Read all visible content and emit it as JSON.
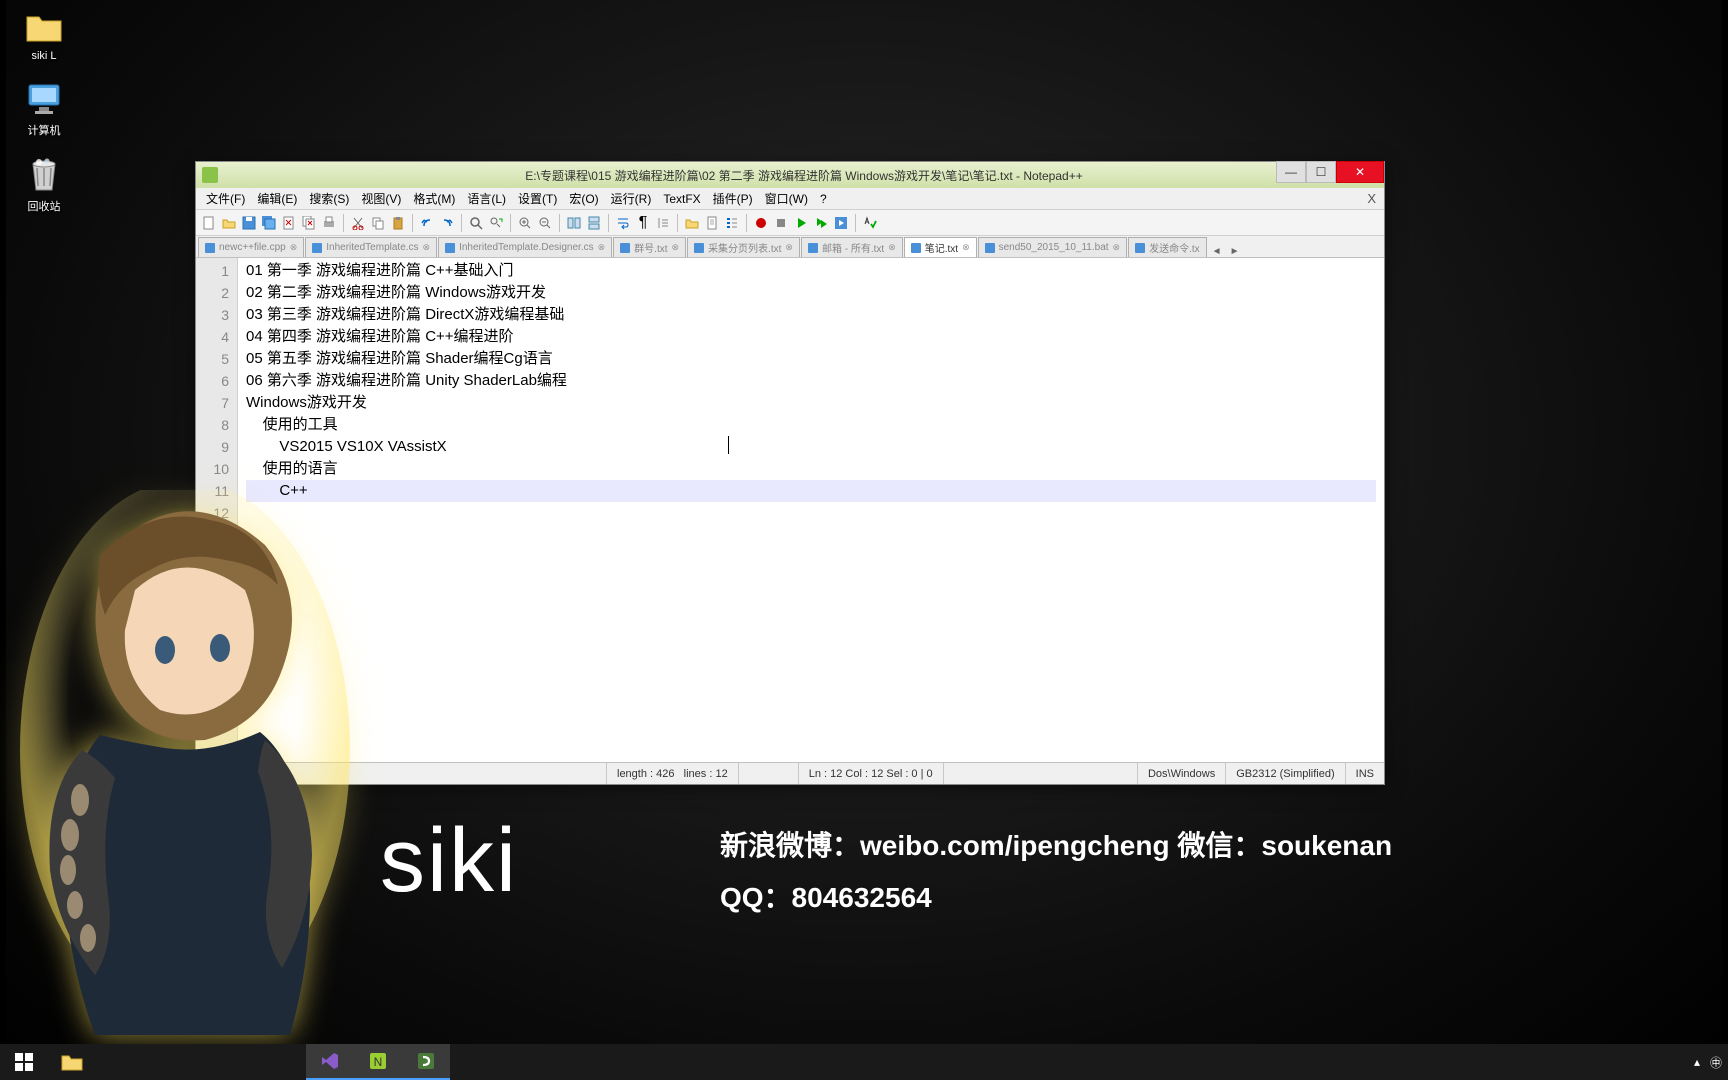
{
  "desktop": {
    "icons": [
      {
        "name": "folder-siki-l",
        "label": "siki L",
        "type": "folder"
      },
      {
        "name": "computer",
        "label": "计算机",
        "type": "computer"
      },
      {
        "name": "recycle-bin",
        "label": "回收站",
        "type": "recycle"
      }
    ]
  },
  "window": {
    "title": "E:\\专题课程\\015 游戏编程进阶篇\\02 第二季 游戏编程进阶篇 Windows游戏开发\\笔记\\笔记.txt - Notepad++",
    "menus": [
      "文件(F)",
      "编辑(E)",
      "搜索(S)",
      "视图(V)",
      "格式(M)",
      "语言(L)",
      "设置(T)",
      "宏(O)",
      "运行(R)",
      "TextFX",
      "插件(P)",
      "窗口(W)",
      "?"
    ],
    "tabs": [
      {
        "label": "newc++file.cpp",
        "active": false
      },
      {
        "label": "InheritedTemplate.cs",
        "active": false
      },
      {
        "label": "InheritedTemplate.Designer.cs",
        "active": false
      },
      {
        "label": "群号.txt",
        "active": false
      },
      {
        "label": "采集分页列表.txt",
        "active": false
      },
      {
        "label": "邮箱 - 所有.txt",
        "active": false
      },
      {
        "label": "笔记.txt",
        "active": true
      },
      {
        "label": "send50_2015_10_11.bat",
        "active": false
      },
      {
        "label": "发送命令.tx",
        "active": false
      }
    ],
    "lines": [
      "01 第一季 游戏编程进阶篇 C++基础入门",
      "02 第二季 游戏编程进阶篇 Windows游戏开发",
      "03 第三季 游戏编程进阶篇 DirectX游戏编程基础",
      "04 第四季 游戏编程进阶篇 C++编程进阶",
      "05 第五季 游戏编程进阶篇 Shader编程Cg语言",
      "06 第六季 游戏编程进阶篇 Unity ShaderLab编程",
      "",
      "Windows游戏开发",
      "    使用的工具",
      "        VS2015 VS10X VAssistX",
      "    使用的语言",
      "        C++"
    ],
    "status": {
      "length": "length : 426",
      "lines": "lines : 12",
      "pos": "Ln : 12    Col : 12    Sel : 0 | 0",
      "eol": "Dos\\Windows",
      "enc": "GB2312 (Simplified)",
      "ins": "INS"
    }
  },
  "banner": {
    "name": "siki",
    "line1": "新浪微博：weibo.com/ipengcheng 微信：soukenan",
    "line2": "QQ：804632564"
  }
}
